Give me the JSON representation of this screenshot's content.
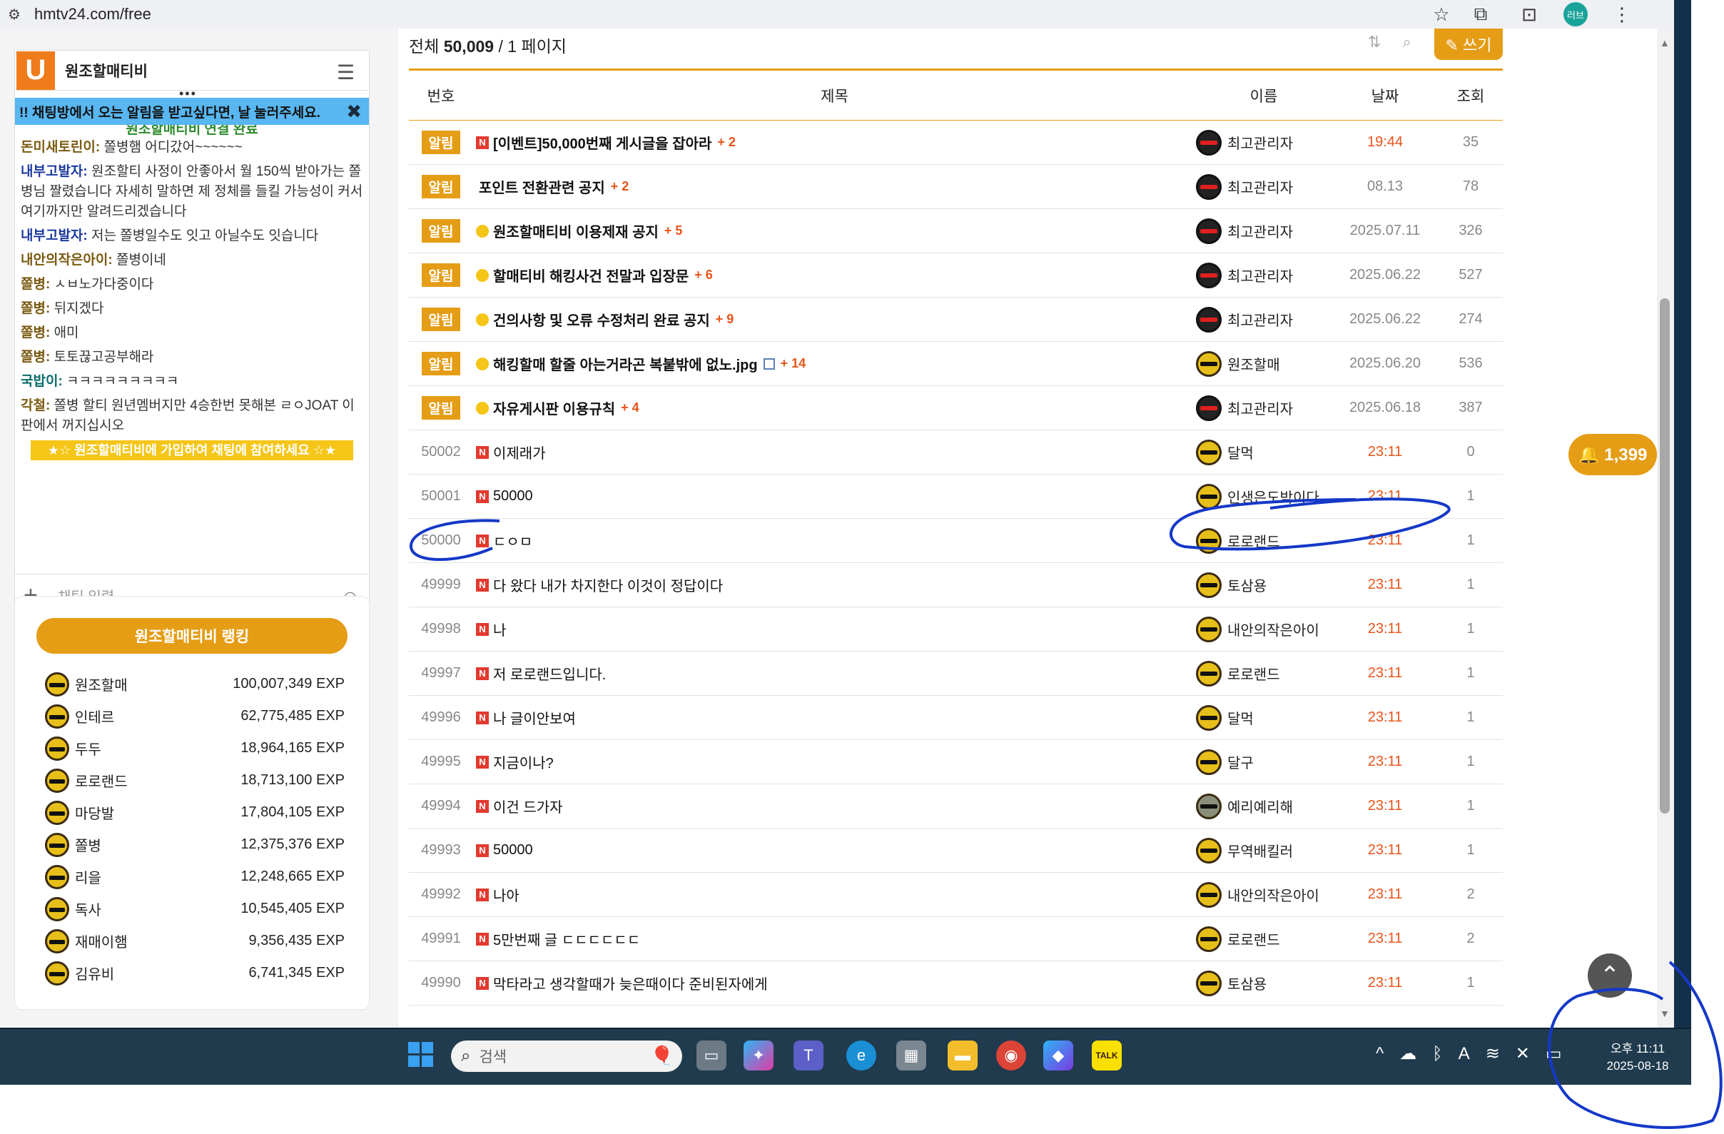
{
  "browser": {
    "url": "hmtv24.com/free",
    "profile_label": "러브"
  },
  "chat": {
    "title": "원조할매티비",
    "notice": "!! 채팅방에서 오는 알림을 받고싶다면, 날 눌러주세요.",
    "connected": "원조할매티비 연결 완료",
    "messages": [
      {
        "user": "돈미새토린이:",
        "text": " 쫄병햄 어디갔어~~~~~~"
      },
      {
        "user": "내부고발자:",
        "text": " 원조할티 사정이 안좋아서 월 150씩 받아가는 쫄병님 짤렸습니다 자세히 말하면 제 정체를 들킬 가능성이 커서 여기까지만 알려드리겠습니다"
      },
      {
        "user": "내부고발자:",
        "text": " 저는 쫄병일수도 잇고 아닐수도 잇습니다"
      },
      {
        "user": "내안의작은아이:",
        "text": " 쫄병이네"
      },
      {
        "user": "쫄병:",
        "text": " ㅅㅂ노가다중이다"
      },
      {
        "user": "쫄병:",
        "text": " 뒤지겠다"
      },
      {
        "user": "쫄병:",
        "text": " 애미"
      },
      {
        "user": "쫄병:",
        "text": " 토토끊고공부해라"
      },
      {
        "user": "국밥이:",
        "text": " ㅋㅋㅋㅋㅋㅋㅋㅋㅋ"
      },
      {
        "user": "각철:",
        "text": " 쫄병 할티 원년멤버지만 4승한번 못해본 ㄹㅇJOAT 이판에서 꺼지십시오"
      }
    ],
    "join_banner": "★☆ 원조할매티비에 가입하여 채팅에 참여하세요 ☆★",
    "input_placeholder": "채팅 입력."
  },
  "ranking": {
    "button": "원조할매티비 랭킹",
    "rows": [
      {
        "name": "원조할매",
        "exp": "100,007,349 EXP"
      },
      {
        "name": "인테르",
        "exp": "62,775,485 EXP"
      },
      {
        "name": "두두",
        "exp": "18,964,165 EXP"
      },
      {
        "name": "로로랜드",
        "exp": "18,713,100 EXP"
      },
      {
        "name": "마당발",
        "exp": "17,804,105 EXP"
      },
      {
        "name": "쫄병",
        "exp": "12,375,376 EXP"
      },
      {
        "name": "리을",
        "exp": "12,248,665 EXP"
      },
      {
        "name": "독사",
        "exp": "10,545,405 EXP"
      },
      {
        "name": "재매이햄",
        "exp": "9,356,435 EXP"
      },
      {
        "name": "김유비",
        "exp": "6,741,345 EXP"
      }
    ]
  },
  "board": {
    "total_prefix": "전체 ",
    "total": "50,009",
    "page_info": " / 1 페이지",
    "write_label": "✎ 쓰기",
    "headers": {
      "no": "번호",
      "title": "제목",
      "name": "이름",
      "date": "날짜",
      "views": "조회"
    },
    "notice_label": "알림",
    "notices": [
      {
        "title": "[이벤트]50,000번째 게시글을 잡아라",
        "comments": "+ 2",
        "name": "최고관리자",
        "date": "19:44",
        "views": "35",
        "icon": "new"
      },
      {
        "title": "포인트 전환관련 공지",
        "comments": "+ 2",
        "name": "최고관리자",
        "date": "08.13",
        "views": "78",
        "icon": "none"
      },
      {
        "title": "원조할매티비 이용제재 공지",
        "comments": "+ 5",
        "name": "최고관리자",
        "date": "2025.07.11",
        "views": "326",
        "icon": "bulb"
      },
      {
        "title": "할매티비 해킹사건 전말과 입장문",
        "comments": "+ 6",
        "name": "최고관리자",
        "date": "2025.06.22",
        "views": "527",
        "icon": "bulb"
      },
      {
        "title": "건의사항 및 오류 수정처리 완료 공지",
        "comments": "+ 9",
        "name": "최고관리자",
        "date": "2025.06.22",
        "views": "274",
        "icon": "bulb"
      },
      {
        "title": "해킹할매 할줄 아는거라곤 복붙밖에 없노.jpg",
        "comments": "+ 14",
        "name": "원조할매",
        "date": "2025.06.20",
        "views": "536",
        "icon": "bulb"
      },
      {
        "title": "자유게시판 이용규칙",
        "comments": "+ 4",
        "name": "최고관리자",
        "date": "2025.06.18",
        "views": "387",
        "icon": "bulb"
      }
    ],
    "posts": [
      {
        "no": "50002",
        "title": "이제래가",
        "name": "달먹",
        "date": "23:11",
        "views": "0"
      },
      {
        "no": "50001",
        "title": "50000",
        "name": "인생은도박이다",
        "date": "23:11",
        "views": "1"
      },
      {
        "no": "50000",
        "title": "ㄷㅇㅁ",
        "name": "로로랜드",
        "date": "23:11",
        "views": "1"
      },
      {
        "no": "49999",
        "title": "다 왔다 내가 차지한다 이것이 정답이다",
        "name": "토삼용",
        "date": "23:11",
        "views": "1"
      },
      {
        "no": "49998",
        "title": "나",
        "name": "내안의작은아이",
        "date": "23:11",
        "views": "1"
      },
      {
        "no": "49997",
        "title": "저 로로랜드입니다.",
        "name": "로로랜드",
        "date": "23:11",
        "views": "1"
      },
      {
        "no": "49996",
        "title": "나 글이안보여",
        "name": "달먹",
        "date": "23:11",
        "views": "1"
      },
      {
        "no": "49995",
        "title": "지금이나?",
        "name": "달구",
        "date": "23:11",
        "views": "1"
      },
      {
        "no": "49994",
        "title": "이건 드가자",
        "name": "예리예리해",
        "date": "23:11",
        "views": "1"
      },
      {
        "no": "49993",
        "title": "50000",
        "name": "무역배킬러",
        "date": "23:11",
        "views": "1"
      },
      {
        "no": "49992",
        "title": "나아",
        "name": "내안의작은아이",
        "date": "23:11",
        "views": "2"
      },
      {
        "no": "49991",
        "title": "5만번째 글 ㄷㄷㄷㄷㄷㄷ",
        "name": "로로랜드",
        "date": "23:11",
        "views": "2"
      },
      {
        "no": "49990",
        "title": "막타라고 생각할때가 늦은때이다 준비된자에게",
        "name": "토삼용",
        "date": "23:11",
        "views": "1"
      }
    ]
  },
  "bell": {
    "label": "🔔 1,399"
  },
  "taskbar": {
    "search_placeholder": "검색",
    "time": "오후 11:11",
    "date": "2025-08-18"
  }
}
